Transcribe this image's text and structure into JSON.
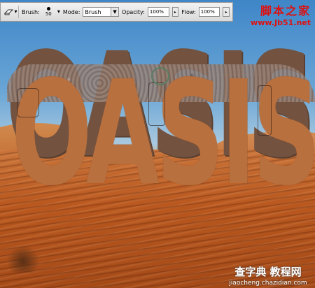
{
  "toolbar": {
    "tool_icon": "eraser-icon",
    "brush_label": "Brush:",
    "brush_size": "50",
    "mode_label": "Mode:",
    "mode_value": "Brush",
    "opacity_label": "Opacity:",
    "opacity_value": "100%",
    "flow_label": "Flow:",
    "flow_value": "100%"
  },
  "canvas": {
    "text": "OASIS"
  },
  "watermark_top": {
    "site_name": "脚本之家",
    "url": "www.Jb51.net"
  },
  "watermark_bottom": {
    "site_name": "查字典 教程网",
    "url": "jiaocheng.chazidian.com"
  },
  "colors": {
    "sky": "#5a98cf",
    "sand": "#b95a22",
    "letter_face": "#b9703f",
    "watermark_red": "#dd1111"
  }
}
